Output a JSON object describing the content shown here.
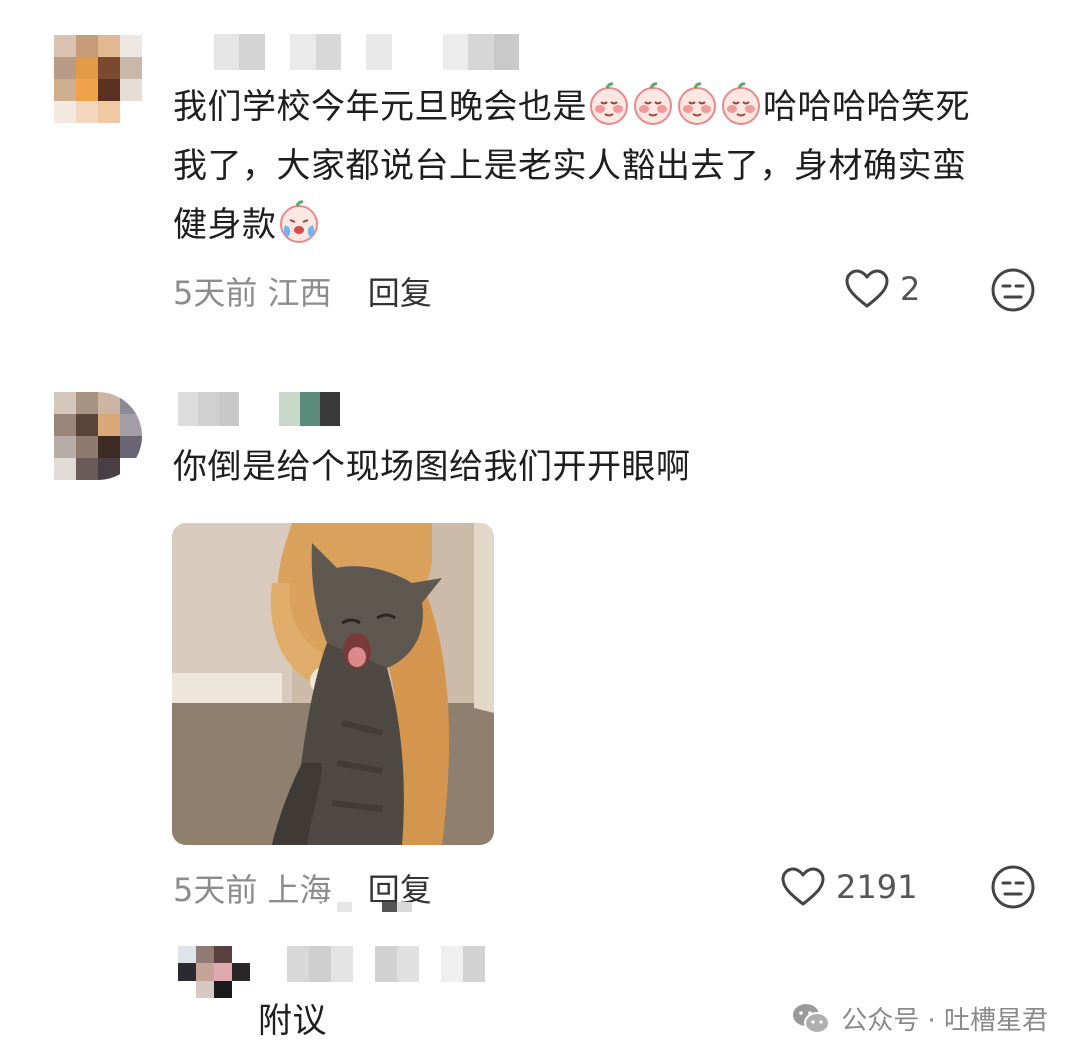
{
  "comments": [
    {
      "text_line1": "我们学校今年元旦晚会也是",
      "text_line1_tail": "哈哈哈哈笑死",
      "text_line2": "我了，大家都说台上是老实人豁出去了，身材确实蛮",
      "text_line3": "健身款",
      "time": "5天前",
      "location": "江西",
      "reply_label": "回复",
      "likes": "2"
    },
    {
      "text": "你倒是给个现场图给我们开开眼啊",
      "time": "5天前",
      "location": "上海",
      "reply_label": "回复",
      "likes": "2191"
    },
    {
      "text": "附议"
    }
  ],
  "watermark": {
    "text": "公众号 · 吐槽星君",
    "icon": "wechat-icon"
  },
  "icons": {
    "like": "heart-outline-icon",
    "dislike": "meh-face-icon",
    "emoji": "shy-peach-emoji-icon",
    "emoji_cry": "crying-peach-emoji-icon"
  },
  "colors": {
    "text": "#1e1e1e",
    "meta": "#8c8c8c",
    "accent_emoji": "#f29a9a"
  }
}
